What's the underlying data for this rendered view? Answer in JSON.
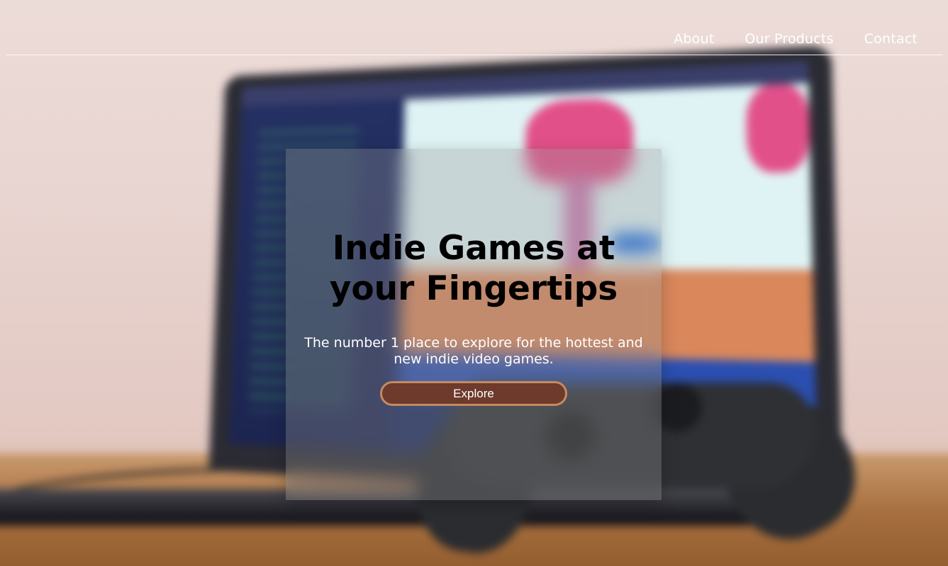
{
  "nav": {
    "items": [
      {
        "label": "About"
      },
      {
        "label": "Our Products"
      },
      {
        "label": "Contact"
      }
    ]
  },
  "hero": {
    "title": "Indie Games at your Fingertips",
    "subtitle": "The number 1 place to explore for the hottest and new indie video games.",
    "button_label": "Explore"
  },
  "background": {
    "subject": "blurred laptop with game on screen and a game controller on a wooden table"
  },
  "colors": {
    "button_fill": "#6d3a2c",
    "button_border": "#c48a61",
    "nav_text": "#ffffff",
    "title_text": "#000000"
  }
}
